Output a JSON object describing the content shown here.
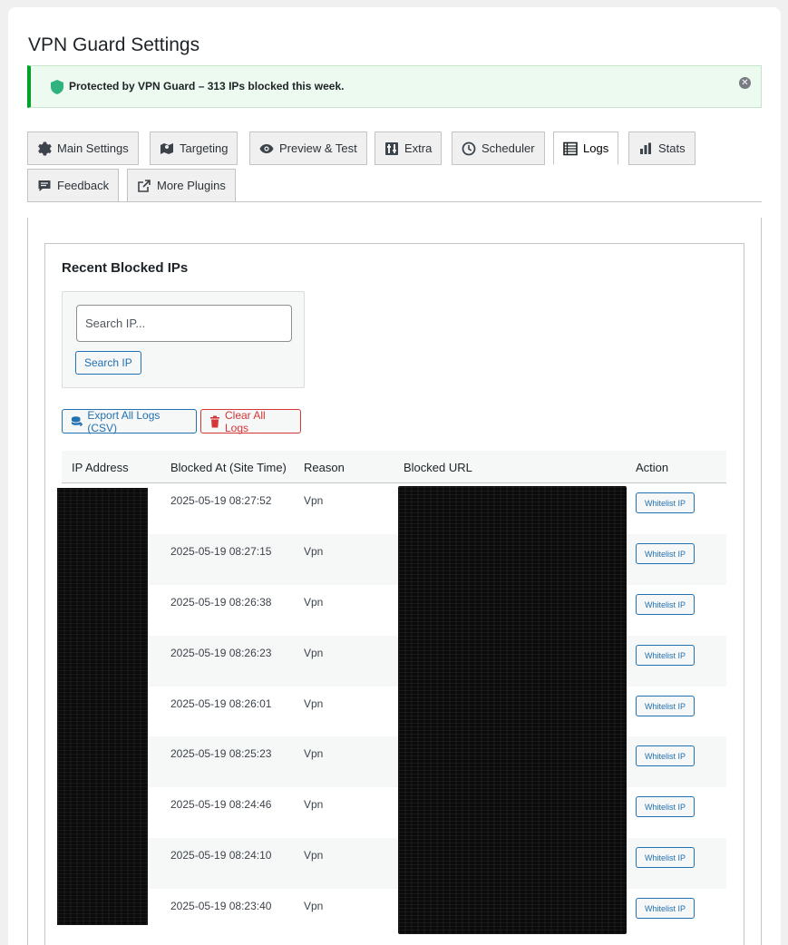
{
  "page": {
    "title": "VPN Guard Settings"
  },
  "notice": {
    "message": "Protected by VPN Guard – 313 IPs blocked this week."
  },
  "tabs": [
    {
      "label": "Main Settings",
      "icon": "gear-icon"
    },
    {
      "label": "Targeting",
      "icon": "map-icon"
    },
    {
      "label": "Preview & Test",
      "icon": "eye-icon"
    },
    {
      "label": "Extra",
      "icon": "sliders-icon"
    },
    {
      "label": "Scheduler",
      "icon": "clock-icon"
    },
    {
      "label": "Logs",
      "icon": "list-icon",
      "active": true
    },
    {
      "label": "Stats",
      "icon": "bar-chart-icon"
    },
    {
      "label": "Feedback",
      "icon": "comment-icon"
    },
    {
      "label": "More Plugins",
      "icon": "external-link-icon"
    }
  ],
  "logs": {
    "section_title": "Recent Blocked IPs",
    "search": {
      "placeholder": "Search IP...",
      "button_label": "Search IP"
    },
    "export_label": "Export All Logs (CSV)",
    "clear_label": "Clear All Logs",
    "columns": [
      "IP Address",
      "Blocked At (Site Time)",
      "Reason",
      "Blocked URL",
      "Action"
    ],
    "rows": [
      {
        "blocked_at": "2025-05-19 08:27:52",
        "reason": "Vpn",
        "action": "Whitelist IP"
      },
      {
        "blocked_at": "2025-05-19 08:27:15",
        "reason": "Vpn",
        "action": "Whitelist IP"
      },
      {
        "blocked_at": "2025-05-19 08:26:38",
        "reason": "Vpn",
        "action": "Whitelist IP"
      },
      {
        "blocked_at": "2025-05-19 08:26:23",
        "reason": "Vpn",
        "action": "Whitelist IP"
      },
      {
        "blocked_at": "2025-05-19 08:26:01",
        "reason": "Vpn",
        "action": "Whitelist IP"
      },
      {
        "blocked_at": "2025-05-19 08:25:23",
        "reason": "Vpn",
        "action": "Whitelist IP"
      },
      {
        "blocked_at": "2025-05-19 08:24:46",
        "reason": "Vpn",
        "action": "Whitelist IP"
      },
      {
        "blocked_at": "2025-05-19 08:24:10",
        "reason": "Vpn",
        "action": "Whitelist IP"
      },
      {
        "blocked_at": "2025-05-19 08:23:40",
        "reason": "Vpn",
        "action": "Whitelist IP"
      }
    ]
  },
  "colors": {
    "accent": "#2271b1",
    "success": "#00a32a",
    "danger": "#d63638",
    "shield": "#2fb27e"
  }
}
